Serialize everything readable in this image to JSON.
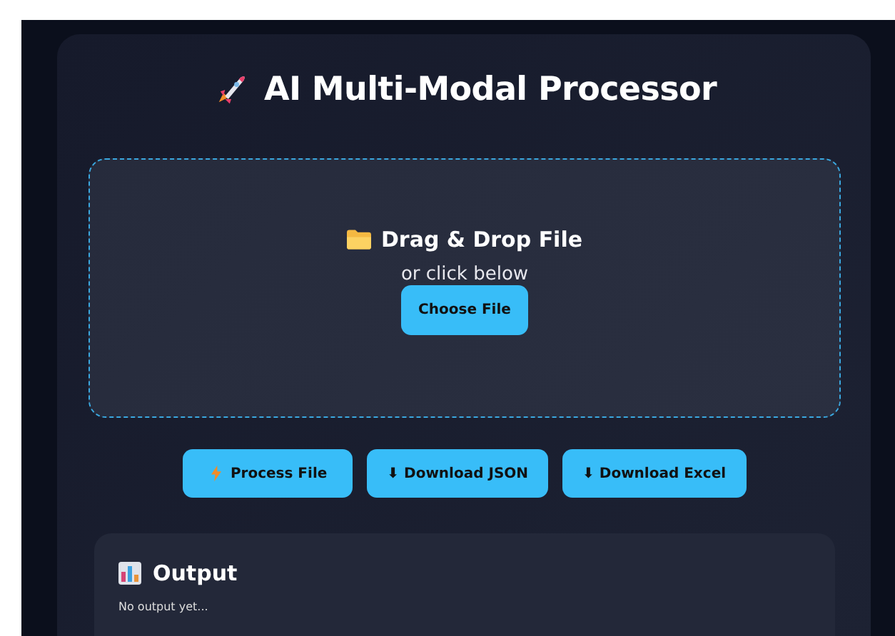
{
  "title": "AI Multi-Modal Processor",
  "dropzone": {
    "heading": "Drag & Drop File",
    "hint": "or click below",
    "button": "Choose File"
  },
  "actions": [
    {
      "kind": "process",
      "label": "Process File"
    },
    {
      "kind": "download",
      "label": "⬇ Download JSON"
    },
    {
      "kind": "download",
      "label": "⬇ Download Excel"
    }
  ],
  "output": {
    "heading": "Output",
    "text": "No output yet..."
  }
}
